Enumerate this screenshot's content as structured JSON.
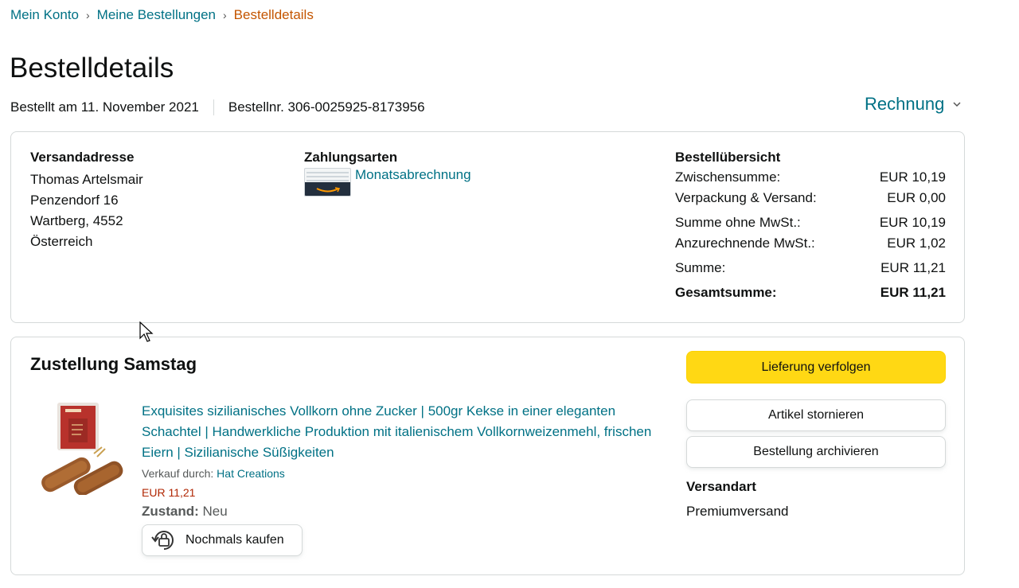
{
  "breadcrumb": {
    "items": [
      "Mein Konto",
      "Meine Bestellungen"
    ],
    "current": "Bestelldetails",
    "separator": "›"
  },
  "page_title": "Bestelldetails",
  "order": {
    "date": "Bestellt am 11. November 2021",
    "number": "Bestellnr. 306-0025925-8173956"
  },
  "invoice_label": "Rechnung",
  "shipping_address": {
    "title": "Versandadresse",
    "lines": [
      "Thomas Artelsmair",
      "Penzendorf 16",
      "Wartberg, 4552",
      "Österreich"
    ]
  },
  "payment": {
    "title": "Zahlungsarten",
    "method": "Monatsabrechnung",
    "icon": "amazon-card-icon"
  },
  "summary": {
    "title": "Bestellübersicht",
    "rows": [
      {
        "label": "Zwischensumme:",
        "value": "EUR 10,19"
      },
      {
        "label": "Verpackung & Versand:",
        "value": "EUR 0,00"
      },
      {
        "label": "Summe ohne MwSt.:",
        "value": "EUR 10,19"
      },
      {
        "label": "Anzurechnende MwSt.:",
        "value": "EUR 1,02"
      },
      {
        "label": "Summe:",
        "value": "EUR 11,21"
      }
    ],
    "total": {
      "label": "Gesamtsumme:",
      "value": "EUR 11,21"
    }
  },
  "delivery": {
    "title": "Zustellung Samstag",
    "product": {
      "title": "Exquisites sizilianisches Vollkorn ohne Zucker | 500gr Kekse in einer eleganten Schachtel | Handwerkliche Produktion mit italienischem Vollkornweizenmehl, frischen Eiern | Sizilianische Süßigkeiten",
      "sold_by_label": "Verkauf durch:",
      "seller": "Hat Creations",
      "price": "EUR 11,21",
      "condition_label": "Zustand:",
      "condition": "Neu"
    },
    "buy_again": "Nochmals kaufen",
    "actions": {
      "track": "Lieferung verfolgen",
      "cancel": "Artikel stornieren",
      "archive": "Bestellung archivieren"
    },
    "shipping_type_title": "Versandart",
    "shipping_type": "Premiumversand"
  },
  "colors": {
    "link": "#007185",
    "breadcrumb_current": "#c45500",
    "price": "#b12704",
    "primary_button": "#ffd814",
    "border": "#d5d9d9"
  }
}
